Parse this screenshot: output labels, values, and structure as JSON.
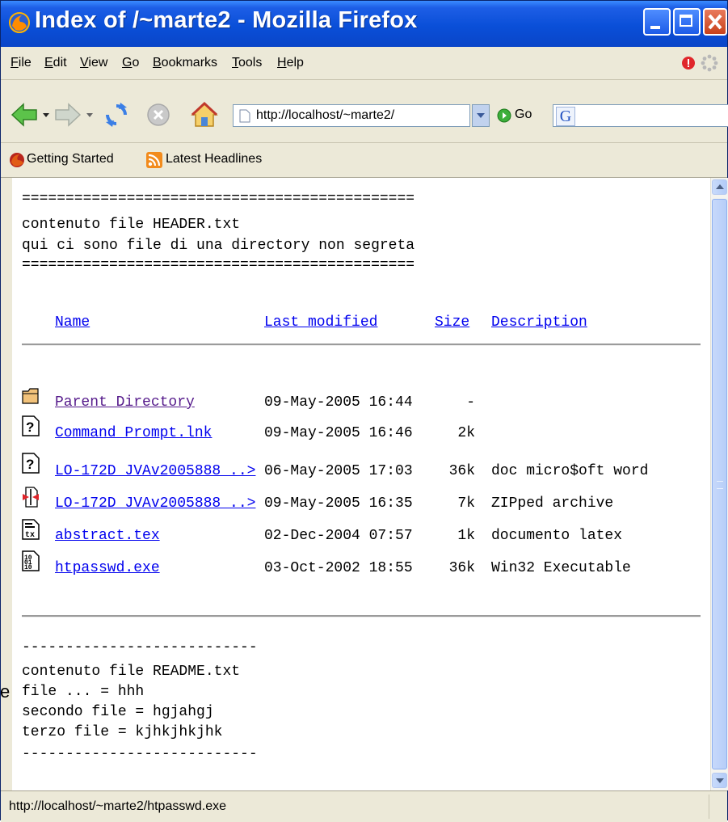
{
  "window": {
    "title": "Index of /~marte2 - Mozilla Firefox"
  },
  "menu": [
    {
      "first": "F",
      "rest": "ile"
    },
    {
      "first": "E",
      "rest": "dit"
    },
    {
      "first": "V",
      "rest": "iew"
    },
    {
      "first": "G",
      "rest": "o"
    },
    {
      "first": "B",
      "rest": "ookmarks"
    },
    {
      "first": "T",
      "rest": "ools"
    },
    {
      "first": "H",
      "rest": "elp"
    }
  ],
  "nav": {
    "url": "http://localhost/~marte2/",
    "go_label": "Go",
    "search_icon": "google-g-icon"
  },
  "bookmarks": [
    {
      "label": "Getting Started",
      "icon": "firefox-icon"
    },
    {
      "label": "Latest Headlines",
      "icon": "rss-icon"
    }
  ],
  "page": {
    "header_rule": "=============================================",
    "header_line1": "contenuto file HEADER.txt",
    "header_line2": "qui ci sono file di una directory non segreta",
    "columns": {
      "name": "Name",
      "last_modified": "Last modified",
      "size": "Size",
      "description": "Description"
    },
    "rows": [
      {
        "icon": "folder-icon",
        "name": "Parent Directory",
        "modified": "09-May-2005 16:44",
        "size": "-",
        "description": ""
      },
      {
        "icon": "unknown-file-icon",
        "name": "Command Prompt.lnk",
        "modified": "09-May-2005 16:46",
        "size": "2k",
        "description": ""
      },
      {
        "icon": "unknown-file-icon",
        "name": "LO-172D JVAv2005888 ..>",
        "modified": "06-May-2005 17:03",
        "size": "36k",
        "description": "doc micro$oft word"
      },
      {
        "icon": "compressed-file-icon",
        "name": "LO-172D JVAv2005888 ..>",
        "modified": "09-May-2005 16:35",
        "size": "7k",
        "description": "ZIPped archive"
      },
      {
        "icon": "tex-file-icon",
        "name": "abstract.tex",
        "modified": "02-Dec-2004 07:57",
        "size": "1k",
        "description": "documento latex"
      },
      {
        "icon": "binary-file-icon",
        "name": "htpasswd.exe",
        "modified": "03-Oct-2002 18:55",
        "size": "36k",
        "description": "Win32 Executable"
      }
    ],
    "readme_rule": "---------------------------",
    "readme_lines": [
      "contenuto file README.txt",
      "file ... = hhh",
      "secondo file = hgjahgj",
      "terzo file = kjhkjhkjhk"
    ]
  },
  "status": {
    "text": "http://localhost/~marte2/htpasswd.exe"
  },
  "stray_text": "e"
}
